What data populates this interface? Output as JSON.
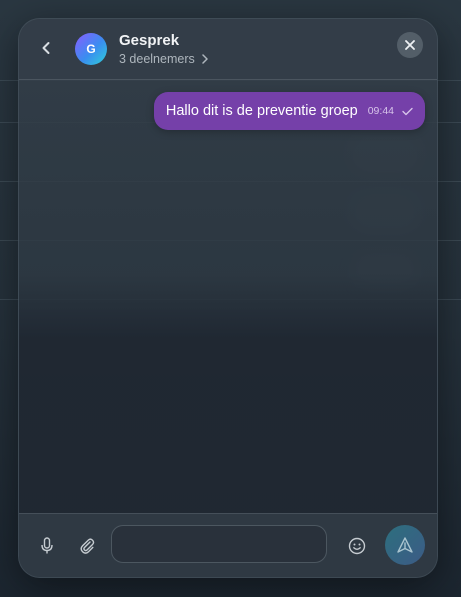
{
  "header": {
    "title": "Gesprek",
    "subtitle": "3 deelnemers",
    "avatar_initial": "G"
  },
  "messages": [
    {
      "text": "Hallo dit is de preventie groep",
      "time": "09:44",
      "status_icon": "check-icon",
      "sent": true
    }
  ],
  "composer": {
    "placeholder": "",
    "value": ""
  },
  "icons": {
    "back": "chevron-left-icon",
    "participants": "chevron-right-icon",
    "close": "close-icon",
    "mic": "microphone-icon",
    "attach": "paperclip-icon",
    "emoji": "smiley-icon",
    "send": "send-icon"
  },
  "colors": {
    "message_bubble": "#7540a9",
    "send_button": "#2d6f7e",
    "avatar_gradient": [
      "#8a5cff",
      "#2fd0d8"
    ]
  }
}
